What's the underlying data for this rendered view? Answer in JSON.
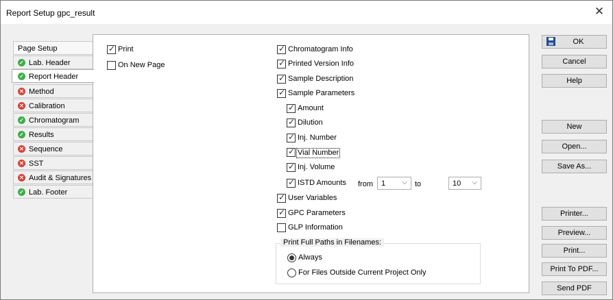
{
  "window": {
    "title": "Report Setup gpc_result",
    "close": "✕"
  },
  "tabs": [
    {
      "label": "Page Setup",
      "status": "none"
    },
    {
      "label": "Lab. Header",
      "status": "ok"
    },
    {
      "label": "Report Header",
      "status": "ok",
      "active": true
    },
    {
      "label": "Method",
      "status": "error"
    },
    {
      "label": "Calibration",
      "status": "error"
    },
    {
      "label": "Chromatogram",
      "status": "ok"
    },
    {
      "label": "Results",
      "status": "ok"
    },
    {
      "label": "Sequence",
      "status": "error"
    },
    {
      "label": "SST",
      "status": "error"
    },
    {
      "label": "Audit & Signatures",
      "status": "error"
    },
    {
      "label": "Lab. Footer",
      "status": "ok"
    }
  ],
  "options": {
    "print": {
      "label": "Print",
      "checked": true
    },
    "on_new_page": {
      "label": "On New Page",
      "checked": false
    },
    "chromatogram_info": {
      "label": "Chromatogram Info",
      "checked": true
    },
    "printed_version_info": {
      "label": "Printed Version Info",
      "checked": true
    },
    "sample_description": {
      "label": "Sample Description",
      "checked": true
    },
    "sample_parameters": {
      "label": "Sample Parameters",
      "checked": true
    },
    "amount": {
      "label": "Amount",
      "checked": true
    },
    "dilution": {
      "label": "Dilution",
      "checked": true
    },
    "inj_number": {
      "label": "Inj. Number",
      "checked": true
    },
    "vial_number": {
      "label": "Vial Number",
      "checked": true
    },
    "inj_volume": {
      "label": "Inj. Volume",
      "checked": true
    },
    "istd_amounts": {
      "label": "ISTD Amounts",
      "checked": true
    },
    "user_variables": {
      "label": "User Variables",
      "checked": true
    },
    "gpc_parameters": {
      "label": "GPC Parameters",
      "checked": true
    },
    "glp_information": {
      "label": "GLP Information",
      "checked": false
    }
  },
  "istd_range": {
    "from_label": "from",
    "from_value": "1",
    "to_label": "to",
    "to_value": "10"
  },
  "paths_group": {
    "title": "Print Full Paths in Filenames:",
    "always": "Always",
    "outside": "For Files Outside Current Project Only",
    "selected": "always"
  },
  "buttons": {
    "ok": "OK",
    "cancel": "Cancel",
    "help": "Help",
    "new": "New",
    "open": "Open...",
    "save_as": "Save As...",
    "printer": "Printer...",
    "preview": "Preview...",
    "print": "Print...",
    "print_to_pdf": "Print To PDF...",
    "send_pdf": "Send PDF"
  },
  "colors": {
    "ok": "#3eae49",
    "error": "#d9423b",
    "floppy": "#1f4d8c"
  }
}
